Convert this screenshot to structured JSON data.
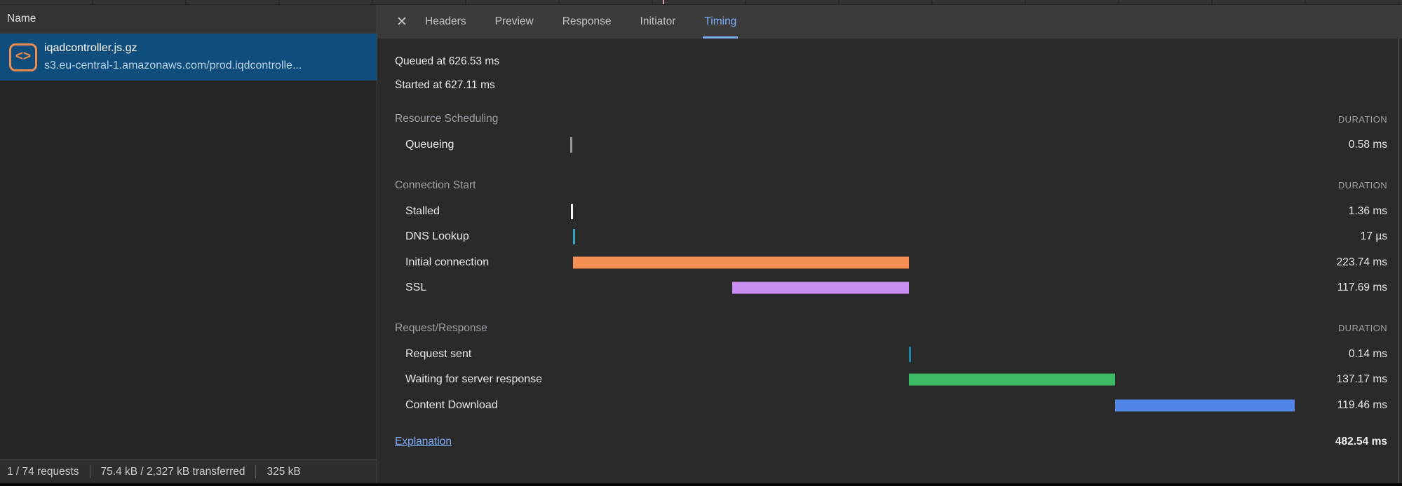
{
  "colors": {
    "accent_blue": "#7cacf8",
    "selected_row": "#0f4d7c",
    "icon_orange": "#ee8c4e",
    "bar_queueing": "#95999d",
    "bar_stalled": "#f2f2f2",
    "bar_dns": "#38a3c0",
    "bar_initial_connection": "#f78e54",
    "bar_ssl": "#c88ef2",
    "bar_request_sent": "#1d83a6",
    "bar_waiting": "#3cba64",
    "bar_download": "#5185e8"
  },
  "left_panel": {
    "name_header": "Name",
    "selected_request": {
      "file_icon_glyph": "<>",
      "name": "iqadcontroller.js.gz",
      "url": "s3.eu-central-1.amazonaws.com/prod.iqdcontrolle..."
    },
    "status_bar": {
      "items": [
        "1 / 74 requests",
        "75.4 kB / 2,327 kB transferred",
        "325 kB"
      ]
    }
  },
  "tabs": {
    "close_glyph": "✕",
    "items": [
      {
        "label": "Headers",
        "active": false
      },
      {
        "label": "Preview",
        "active": false
      },
      {
        "label": "Response",
        "active": false
      },
      {
        "label": "Initiator",
        "active": false
      },
      {
        "label": "Timing",
        "active": true
      }
    ]
  },
  "timing": {
    "queued_at": "Queued at 626.53 ms",
    "started_at": "Started at 627.11 ms",
    "duration_header": "DURATION",
    "total_duration_ms": 482.54,
    "sections": [
      {
        "title": "Resource Scheduling",
        "rows": [
          {
            "label": "Queueing",
            "value": "0.58 ms",
            "start_ms": 0,
            "duration_ms": 0.58,
            "type": "tick",
            "color_key": "bar_queueing"
          }
        ]
      },
      {
        "title": "Connection Start",
        "rows": [
          {
            "label": "Stalled",
            "value": "1.36 ms",
            "start_ms": 0.58,
            "duration_ms": 1.36,
            "type": "tick",
            "color_key": "bar_stalled"
          },
          {
            "label": "DNS Lookup",
            "value": "17 µs",
            "start_ms": 1.94,
            "duration_ms": 0.02,
            "type": "tick",
            "color_key": "bar_dns"
          },
          {
            "label": "Initial connection",
            "value": "223.74 ms",
            "start_ms": 1.96,
            "duration_ms": 223.74,
            "type": "bar",
            "color_key": "bar_initial_connection"
          },
          {
            "label": "SSL",
            "value": "117.69 ms",
            "start_ms": 108.01,
            "duration_ms": 117.69,
            "type": "bar",
            "color_key": "bar_ssl"
          }
        ]
      },
      {
        "title": "Request/Response",
        "rows": [
          {
            "label": "Request sent",
            "value": "0.14 ms",
            "start_ms": 225.7,
            "duration_ms": 0.14,
            "type": "tick",
            "color_key": "bar_request_sent"
          },
          {
            "label": "Waiting for server response",
            "value": "137.17 ms",
            "start_ms": 225.84,
            "duration_ms": 137.17,
            "type": "bar",
            "color_key": "bar_waiting"
          },
          {
            "label": "Content Download",
            "value": "119.46 ms",
            "start_ms": 363.01,
            "duration_ms": 119.46,
            "type": "bar",
            "color_key": "bar_download"
          }
        ]
      }
    ],
    "explanation_label": "Explanation",
    "total": "482.54 ms"
  }
}
